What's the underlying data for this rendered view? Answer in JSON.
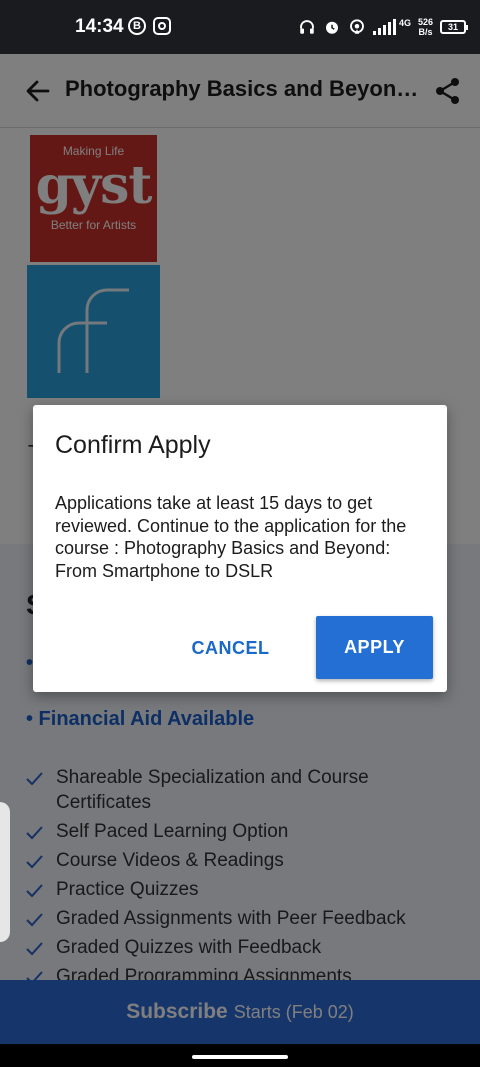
{
  "status_bar": {
    "time": "14:34",
    "b_glyph": "B",
    "net_speed_value": "526",
    "net_speed_unit": "B/s",
    "network_type": "4G",
    "battery": "31",
    "icons": [
      "b-circle-icon",
      "instagram-icon",
      "headphones-icon",
      "alarm-icon",
      "hotspot-icon",
      "signal-icon",
      "battery-icon"
    ]
  },
  "appbar": {
    "title": "Photography Basics and Beyond: From Smartphone to DSLR",
    "back_icon": "arrow-left-icon",
    "share_icon": "share-icon"
  },
  "logos": {
    "gyst": {
      "top": "Making Life",
      "mid": "gyst",
      "bottom": "Better for Artists",
      "color": "#c8302b"
    },
    "f_logo_color": "#2ba0dc"
  },
  "content": {
    "partial_text": "T",
    "section_heading": "S",
    "bullet_1": "•",
    "financial_aid": "• Financial Aid Available",
    "features": [
      "Shareable Specialization and Course Certificates",
      "Self Paced Learning Option",
      "Course Videos & Readings",
      "Practice Quizzes",
      "Graded Assignments with Peer Feedback",
      "Graded Quizzes with Feedback",
      "Graded Programming Assignments"
    ]
  },
  "subscribe": {
    "label": "Subscribe",
    "date": "Starts (Feb 02)",
    "color": "#2b6ad6"
  },
  "dialog": {
    "title": "Confirm Apply",
    "body": "Applications take at least 15 days to get reviewed. Continue to the application for the course : Photography Basics and Beyond: From Smartphone to DSLR",
    "cancel_label": "CANCEL",
    "apply_label": "APPLY",
    "accent": "#236fd3"
  }
}
